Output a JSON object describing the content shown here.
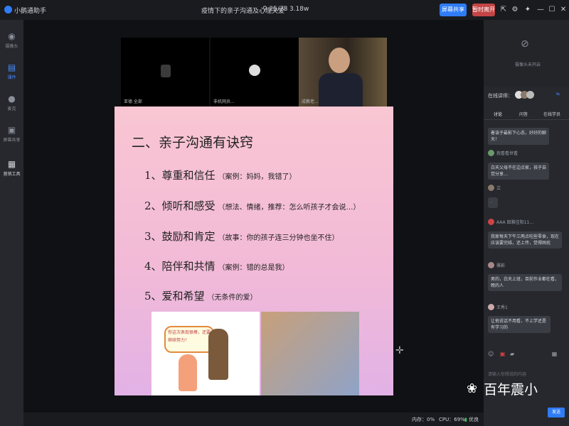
{
  "app": {
    "name": "小鹅通助手",
    "logo_icon": "app-logo-icon"
  },
  "meeting": {
    "title": "疫情下的亲子沟通及心理关爱",
    "viewers": "25/78",
    "likes": "3.18w"
  },
  "toolbar": {
    "share_label": "屏幕共享",
    "leave_label": "暂时离开"
  },
  "sidebar": {
    "items": [
      {
        "label": "摄像头",
        "icon": "camera-icon"
      },
      {
        "label": "课件",
        "icon": "courseware-icon",
        "active": true
      },
      {
        "label": "麦克",
        "icon": "mic-icon"
      },
      {
        "label": "屏幕共享",
        "icon": "screen-share-icon"
      },
      {
        "label": "营销工具",
        "icon": "marketing-tools-icon"
      }
    ]
  },
  "videos": [
    {
      "name": "亚德 全部"
    },
    {
      "name": "非机网员..."
    },
    {
      "name": "成教老..."
    }
  ],
  "slide": {
    "title": "二、亲子沟通有诀窍",
    "items": [
      {
        "main": "1、尊重和信任",
        "note": "（案例：妈妈，我错了）"
      },
      {
        "main": "2、倾听和感受",
        "note": "（想法、情绪，推荐：怎么听孩子才会说…）"
      },
      {
        "main": "3、鼓励和肯定",
        "note": "（故事：你的孩子连三分钟也坐不住）"
      },
      {
        "main": "4、陪伴和共情",
        "note": "（案例：错的总是我）"
      },
      {
        "main": "5、爱和希望",
        "note": "（无条件的爱）"
      }
    ],
    "cartoon_bubble": "你这次表现很棒，还要继续努力！"
  },
  "status": {
    "cpu_label": "CPU：",
    "cpu_value": "69%",
    "mem_label": "内存：",
    "mem_value": "0%",
    "network": "优良"
  },
  "right_panel": {
    "camera_off": "摄像头未开启",
    "online_label": "在线讲师：",
    "tabs": [
      "讨论",
      "问答",
      "在线学员"
    ],
    "messages": [
      {
        "name": "",
        "text": "着该子最影下心态，好好的聊天！"
      },
      {
        "name": "我看看世看",
        "text": "白天父母不在边点家，孩子自觉分享…"
      },
      {
        "name": "立",
        "text": "·"
      },
      {
        "name": "AAA 田雅佳阳11…",
        "text": "我家每天下午三两点吃些零食，现在应该要完结，还上传，觉得困扰"
      },
      {
        "name": "雅影",
        "text": "男的，白天上班，目前作业都在看，晚的人"
      },
      {
        "name": "王秀1",
        "text": "让他说话不用看，不上学还是有学习的"
      }
    ],
    "input_placeholder": "请输入你想说的内容",
    "send_label": "发送"
  },
  "watermark": "百年震小"
}
